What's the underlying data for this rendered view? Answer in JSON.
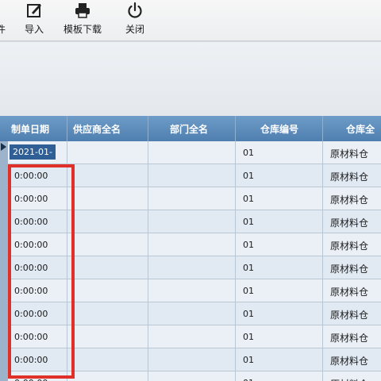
{
  "toolbar": {
    "partial_label": "件",
    "import_label": "导入",
    "template_download_label": "模板下载",
    "close_label": "关闭"
  },
  "table": {
    "columns": [
      "制单日期",
      "供应商全名",
      "部门全名",
      "仓库编号",
      "仓库全"
    ],
    "rows": [
      {
        "date": "2021-01-",
        "code": "01",
        "warehouse": "原材料仓"
      },
      {
        "date": "0:00:00",
        "code": "01",
        "warehouse": "原材料仓"
      },
      {
        "date": "0:00:00",
        "code": "01",
        "warehouse": "原材料仓"
      },
      {
        "date": "0:00:00",
        "code": "01",
        "warehouse": "原材料仓"
      },
      {
        "date": "0:00:00",
        "code": "01",
        "warehouse": "原材料仓"
      },
      {
        "date": "0:00:00",
        "code": "01",
        "warehouse": "原材料仓"
      },
      {
        "date": "0:00:00",
        "code": "01",
        "warehouse": "原材料仓"
      },
      {
        "date": "0:00:00",
        "code": "01",
        "warehouse": "原材料仓"
      },
      {
        "date": "0:00:00",
        "code": "01",
        "warehouse": "原材料仓"
      },
      {
        "date": "0:00:00",
        "code": "01",
        "warehouse": "原材料仓"
      },
      {
        "date": "0:00:00",
        "code": "01",
        "warehouse": "原材料仓"
      }
    ]
  },
  "colors": {
    "header": "#5a88b8",
    "highlight": "#e0302a",
    "selected_cell": "#2f5f95"
  }
}
